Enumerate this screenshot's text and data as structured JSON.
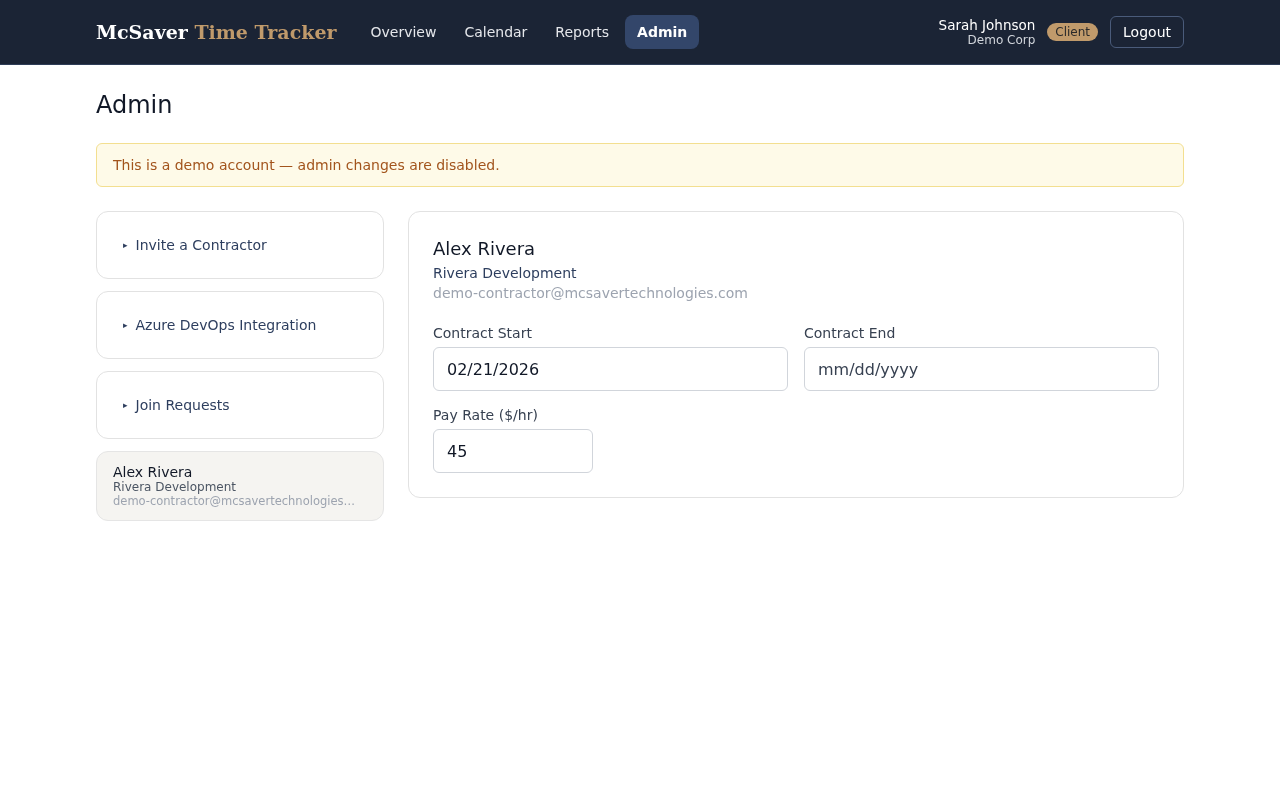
{
  "brand": {
    "name": "McSaver",
    "product": "Time Tracker"
  },
  "nav": [
    {
      "label": "Overview",
      "selected": false
    },
    {
      "label": "Calendar",
      "selected": false
    },
    {
      "label": "Reports",
      "selected": false
    },
    {
      "label": "Admin",
      "selected": true
    }
  ],
  "user": {
    "name": "Sarah Johnson",
    "company": "Demo Corp",
    "role": "Client"
  },
  "logout": "Logout",
  "page_title": "Admin",
  "alert": "This is a demo account — admin changes are disabled.",
  "sections": [
    {
      "marker": "▸",
      "label": "Invite a Contractor",
      "expanded": false
    },
    {
      "marker": "▸",
      "label": "Azure DevOps Integration",
      "expanded": false
    },
    {
      "marker": "▸",
      "label": "Join Requests",
      "expanded": false
    }
  ],
  "contractors": [
    {
      "name": "Alex Rivera",
      "company": "Rivera Development",
      "email": "demo-contractor@mcsavertechnologies…",
      "selected": true
    }
  ],
  "detail": {
    "name": "Alex Rivera",
    "company": "Rivera Development",
    "email": "demo-contractor@mcsavertechnologies.com",
    "fields": [
      {
        "label": "Contract Start",
        "value": "02/21/2026"
      },
      {
        "label": "Contract End",
        "placeholder": "mm/dd/yyyy"
      },
      {
        "label": "Pay Rate ($/hr)",
        "value": "45"
      }
    ]
  }
}
